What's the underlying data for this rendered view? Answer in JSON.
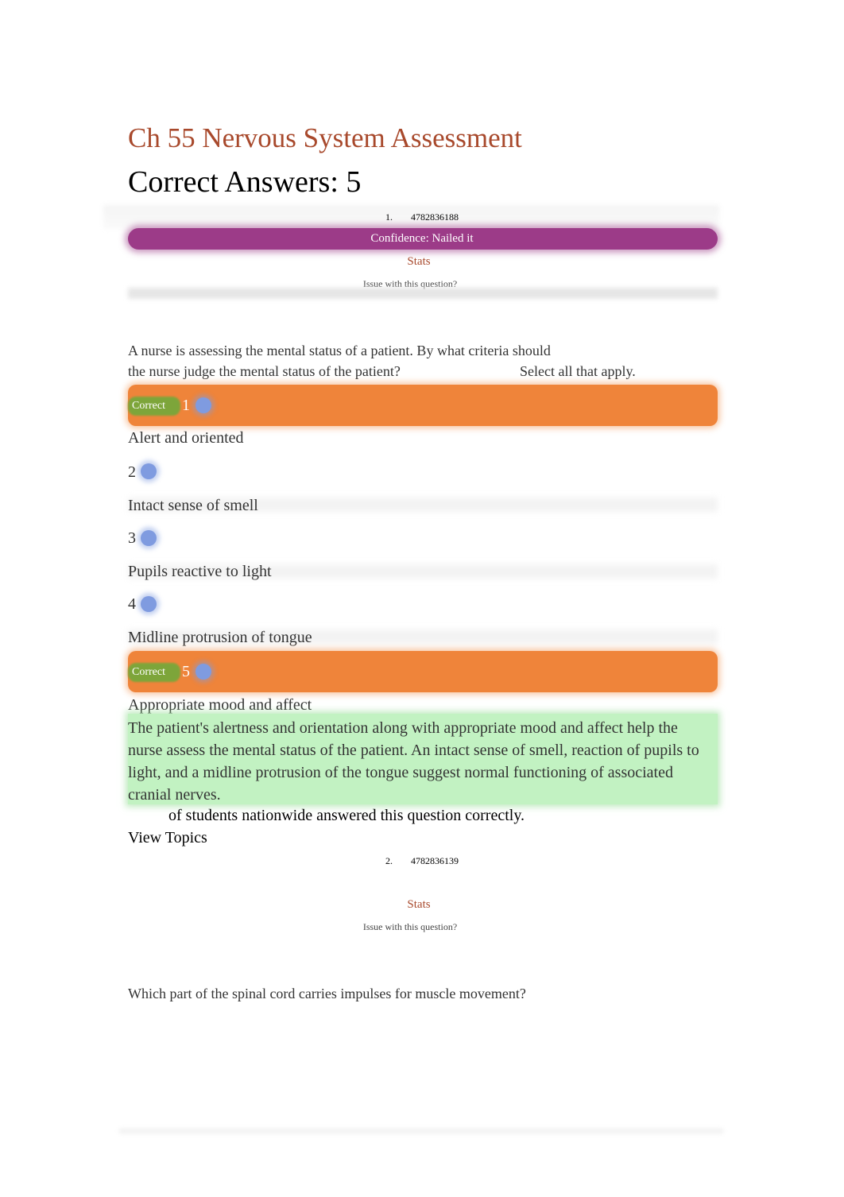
{
  "page": {
    "title": "Ch 55 Nervous System Assessment",
    "correct_answers": "Correct Answers: 5"
  },
  "questions": [
    {
      "number": "1.",
      "id": "4782836188",
      "confidence": "Confidence: Nailed it",
      "stats_label": "Stats",
      "issue_label": "Issue with this question?",
      "text_line1": "A nurse is assessing the mental status of a patient. By what criteria should",
      "text_line2": "the nurse judge the mental status of the patient?",
      "instruction": "Select all that apply.",
      "options": [
        {
          "num": "1",
          "label": "Alert and oriented",
          "correct": true,
          "badge": "Correct"
        },
        {
          "num": "2",
          "label": "Intact sense of smell",
          "correct": false
        },
        {
          "num": "3",
          "label": "Pupils reactive to light",
          "correct": false
        },
        {
          "num": "4",
          "label": "Midline protrusion of tongue",
          "correct": false
        },
        {
          "num": "5",
          "label": "Appropriate mood and affect",
          "correct": true,
          "badge": "Correct"
        }
      ],
      "rationale": "The patient's alertness and orientation along with appropriate mood and affect help the nurse assess the mental status of the patient. An intact sense of smell, reaction of pupils to light, and a midline protrusion of the tongue suggest normal functioning of associated cranial nerves.",
      "nationwide": "of students nationwide answered this question correctly.",
      "view_topics": "View Topics"
    },
    {
      "number": "2.",
      "id": "4782836139",
      "stats_label": "Stats",
      "issue_label": "Issue with this question?",
      "text": "Which part of the spinal cord carries impulses for muscle movement?"
    }
  ],
  "colors": {
    "title": "#a8492c",
    "confidence": "#9c3b88",
    "correct_row": "#ef843a",
    "correct_badge": "#7da53a",
    "rationale_bg": "#c2f2c2",
    "radio": "#7f9be0"
  }
}
